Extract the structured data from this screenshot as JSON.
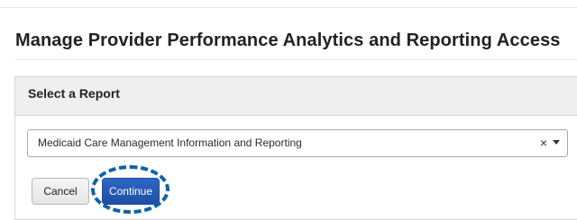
{
  "page": {
    "title": "Manage Provider Performance Analytics and Reporting Access"
  },
  "panel": {
    "title": "Select a Report",
    "select": {
      "value": "Medicaid Care Management Information and Reporting",
      "clear_icon": "×",
      "dropdown_icon": "chevron-down"
    }
  },
  "actions": {
    "cancel_label": "Cancel",
    "continue_label": "Continue"
  },
  "colors": {
    "highlight": "#0E62A9",
    "primary_button": "#2F67C6"
  }
}
